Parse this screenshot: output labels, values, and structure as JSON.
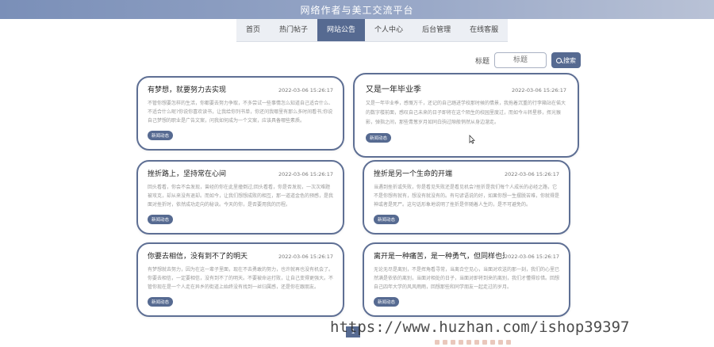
{
  "header": {
    "title": "网络作者与美工交流平台"
  },
  "nav": {
    "items": [
      {
        "label": "首页",
        "active": false
      },
      {
        "label": "热门帖子",
        "active": false
      },
      {
        "label": "网站公告",
        "active": true
      },
      {
        "label": "个人中心",
        "active": false
      },
      {
        "label": "后台管理",
        "active": false
      },
      {
        "label": "在线客服",
        "active": false
      }
    ]
  },
  "search": {
    "label": "标题",
    "placeholder": "标题",
    "button_label": "搜索",
    "icon": "search-icon"
  },
  "cards": [
    {
      "title": "有梦想，就要努力去实现",
      "date": "2022-03-06 15:26:17",
      "body": "不管你想要怎样的生活，你都要去努力争取，不多尝试一些事情怎么知道自己适合什么、不适合什么呢?你说你喜欢读书，让我给你列书单，你还问我哪里有那么多时间看书;你说自己梦想的职业是广告文案，问我如何成为一个文案，应该具备哪些素质。",
      "tag": "新闻动态"
    },
    {
      "title": "又是一年毕业季",
      "date": "2022-03-06 15:26:17",
      "body": "又是一年毕业季，感慨万千，还记的自己踏进学校那时候的情景，我拖着沉重的行李箱站在偌大的数字楼前面，感叹自己未来的日子即将在这个陌生的校园里度过，而如今斗转星移，挥光猴影，弹指之间，那些青葱岁月如同白驹过隙般悄然从身边溜走。",
      "tag": "新闻动态"
    },
    {
      "title": "挫折路上，坚持常在心间",
      "date": "2022-03-06 15:26:17",
      "body": "回头看看，你会不会发现，曾经的你在此里撞倒过;回头看看，你是否发现，一次次难题被攻克，却从来没有退却。而如今，让我们想想成败的相互，那一道道金色的预感，是我面对挫折时，依然成功走向的秘诀。今天的你，是否要用我的历程。",
      "tag": "新闻动态"
    },
    {
      "title": "挫折是另一个生命的开端",
      "date": "2022-03-06 15:26:17",
      "body": "当遇到挫折或失败，你是看见失败还是看见机会?挫折是我们每个人成长的必经之路，它不是你想有就有，想没有就没有的。有句谚语说的好，如果你想一生摆脱苦难，你就得是神或者是死尸。这句话形象地说明了挫折是伴随着人生的，是不可避免的。",
      "tag": "新闻动态"
    },
    {
      "title": "你要去相信，没有到不了的明天",
      "date": "2022-03-06 15:26:17",
      "body": "有梦想就去努力，因为在这一辈子里面，现在不去勇敢的努力，也许就再也没有机会了。你要去相信，一定要相信，没有到不了的明天。不要被命运打败，让自己变得更强大。不管你现在是一个人走在异乡的街道上始终没有找到一丝归属感，还是你在跟朋友。",
      "tag": "新闻动态"
    },
    {
      "title": "离开是一种痛苦，是一种勇气，但同样也是一个考验",
      "date": "2022-03-06 15:26:17",
      "body": "无论无尽是离别，不是挥角看寻常，当离合空见心，当面对欢送的那一刻，我们的心里已然满是依依的离别，当面对相处的日子，当面对即将到来的离别，我们才懂得珍惜。回想自己四年大学的风风雨雨，回想那些和同学朋友一起走过的岁月。",
      "tag": "新闻动态"
    }
  ],
  "pagination": {
    "current": "1"
  },
  "watermark": "https://www.huzhan.com/ishop39397"
}
